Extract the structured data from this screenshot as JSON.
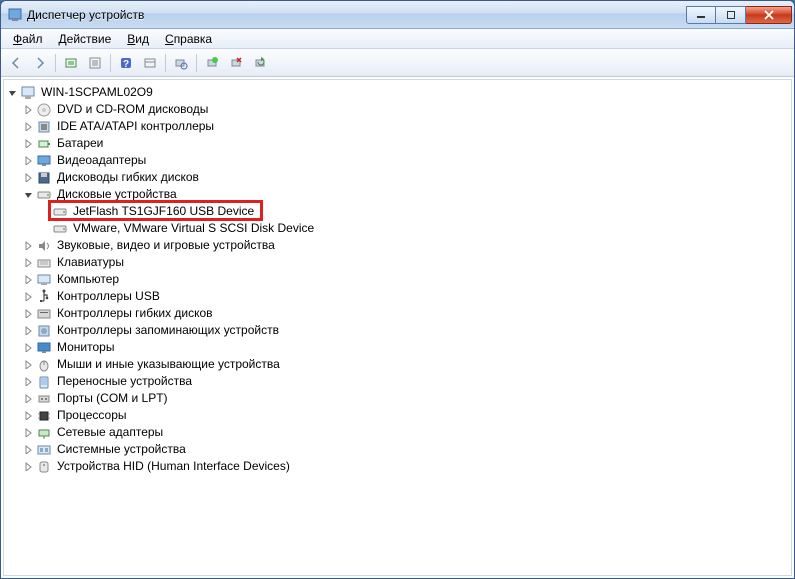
{
  "window": {
    "title": "Диспетчер устройств"
  },
  "menubar": {
    "file": "Файл",
    "action": "Действие",
    "view": "Вид",
    "help": "Справка"
  },
  "tree": {
    "root": "WIN-1SCPAML02O9",
    "categories": [
      {
        "label": "DVD и CD-ROM дисководы",
        "icon": "disc"
      },
      {
        "label": "IDE ATA/ATAPI контроллеры",
        "icon": "chip"
      },
      {
        "label": "Батареи",
        "icon": "battery"
      },
      {
        "label": "Видеоадаптеры",
        "icon": "display"
      },
      {
        "label": "Дисководы гибких дисков",
        "icon": "floppy"
      },
      {
        "label": "Дисковые устройства",
        "icon": "drive",
        "expanded": true,
        "children": [
          {
            "label": "JetFlash TS1GJF160 USB Device",
            "icon": "drive",
            "highlighted": true
          },
          {
            "label": "VMware, VMware Virtual S SCSI Disk Device",
            "icon": "drive"
          }
        ]
      },
      {
        "label": "Звуковые, видео и игровые устройства",
        "icon": "sound"
      },
      {
        "label": "Клавиатуры",
        "icon": "keyboard"
      },
      {
        "label": "Компьютер",
        "icon": "computer"
      },
      {
        "label": "Контроллеры USB",
        "icon": "usb"
      },
      {
        "label": "Контроллеры гибких дисков",
        "icon": "floppy-ctrl"
      },
      {
        "label": "Контроллеры запоминающих устройств",
        "icon": "storage"
      },
      {
        "label": "Мониторы",
        "icon": "monitor"
      },
      {
        "label": "Мыши и иные указывающие устройства",
        "icon": "mouse"
      },
      {
        "label": "Переносные устройства",
        "icon": "portable"
      },
      {
        "label": "Порты (COM и LPT)",
        "icon": "port"
      },
      {
        "label": "Процессоры",
        "icon": "cpu"
      },
      {
        "label": "Сетевые адаптеры",
        "icon": "network"
      },
      {
        "label": "Системные устройства",
        "icon": "system"
      },
      {
        "label": "Устройства HID (Human Interface Devices)",
        "icon": "hid"
      }
    ]
  }
}
